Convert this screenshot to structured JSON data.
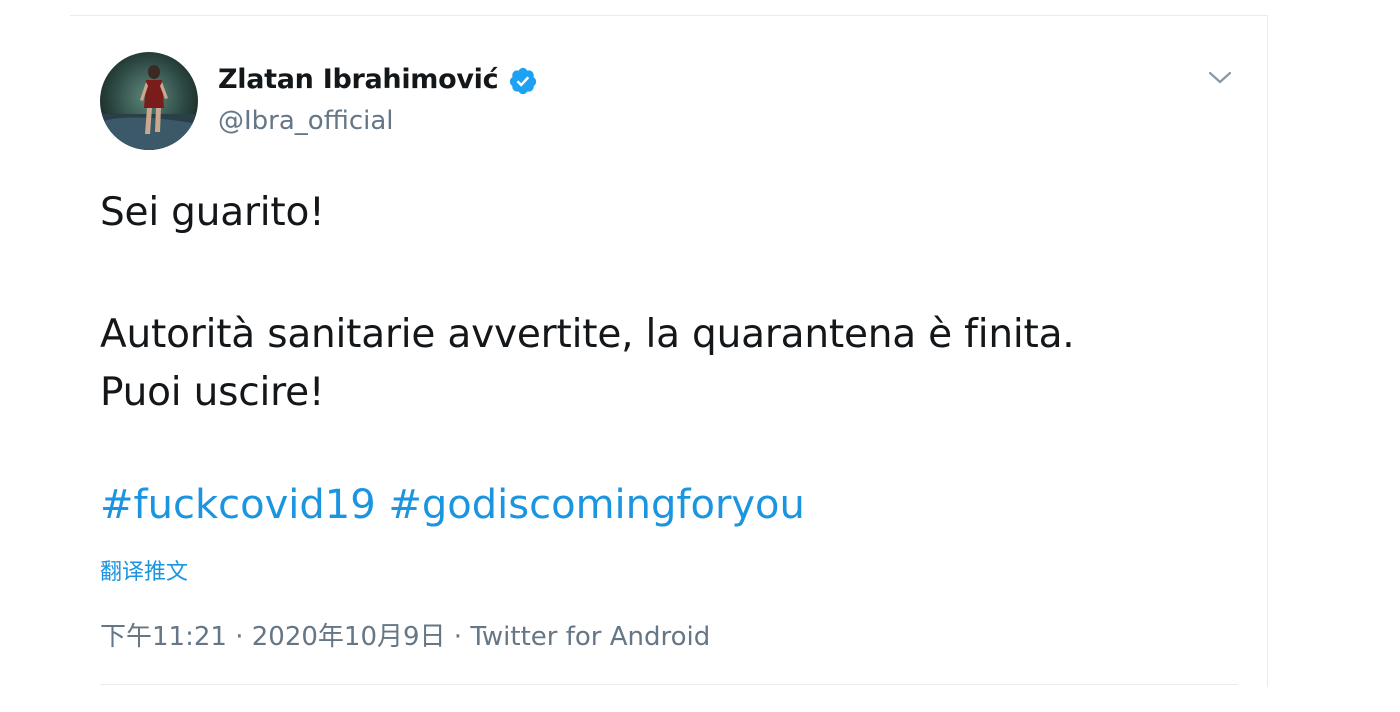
{
  "author": {
    "name": "Zlatan Ibrahimović",
    "handle": "@Ibra_official",
    "verified": true
  },
  "icons": {
    "avatar": "profile-photo",
    "verified": "verified-badge-icon",
    "menu": "chevron-down-icon"
  },
  "tweet": {
    "line1": "Sei guarito!",
    "line2": "Autorità sanitarie avvertite, la quarantena è finita.",
    "line3": "Puoi uscire!",
    "hashtags": [
      "#fuckcovid19",
      "#godiscomingforyou"
    ],
    "translate_label": "翻译推文"
  },
  "meta": {
    "time": "下午11:21",
    "date": "2020年10月9日",
    "source": "Twitter for Android",
    "separator": " · "
  },
  "colors": {
    "link": "#1b95e0",
    "text": "#14171a",
    "secondary": "#657786",
    "border": "#e6ecf0"
  }
}
